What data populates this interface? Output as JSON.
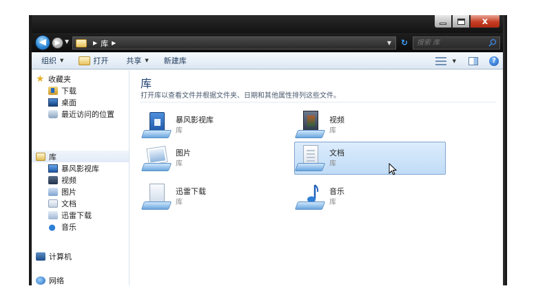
{
  "window": {
    "caption_close": "x"
  },
  "address": {
    "crumb": "库",
    "search_placeholder": "搜索 库"
  },
  "toolbar": {
    "organize": "组织",
    "open": "打开",
    "share": "共享",
    "new_library": "新建库"
  },
  "sidebar": {
    "favorites": {
      "label": "收藏夹",
      "items": [
        {
          "label": "下载",
          "icon": "download-folder-icon"
        },
        {
          "label": "桌面",
          "icon": "desktop-icon"
        },
        {
          "label": "最近访问的位置",
          "icon": "recent-places-icon"
        }
      ]
    },
    "libraries": {
      "label": "库",
      "items": [
        {
          "label": "暴风影视库",
          "icon": "baofeng-library-icon"
        },
        {
          "label": "视频",
          "icon": "video-library-icon"
        },
        {
          "label": "图片",
          "icon": "pictures-library-icon"
        },
        {
          "label": "文档",
          "icon": "documents-library-icon"
        },
        {
          "label": "迅雷下载",
          "icon": "xunlei-library-icon"
        },
        {
          "label": "音乐",
          "icon": "music-library-icon"
        }
      ]
    },
    "computer": "计算机",
    "network": "网络"
  },
  "main": {
    "title": "库",
    "subtitle": "打开库以查看文件并根据文件夹、日期和其他属性排列这些文件。",
    "libraries": [
      {
        "name": "暴风影视库",
        "type": "库",
        "icon": "baofeng-library-icon",
        "selected": false
      },
      {
        "name": "视频",
        "type": "库",
        "icon": "video-library-icon",
        "selected": false
      },
      {
        "name": "图片",
        "type": "库",
        "icon": "pictures-library-icon",
        "selected": false
      },
      {
        "name": "文档",
        "type": "库",
        "icon": "documents-library-icon",
        "selected": true
      },
      {
        "name": "迅雷下载",
        "type": "库",
        "icon": "xunlei-library-icon",
        "selected": false
      },
      {
        "name": "音乐",
        "type": "库",
        "icon": "music-library-icon",
        "selected": false
      }
    ]
  },
  "colors": {
    "chrome_dark": "#121212",
    "toolbar_text": "#1e395b",
    "selection_fill": "#c1dcf7",
    "selection_border": "#7da2ce",
    "close_red": "#c53d23"
  }
}
